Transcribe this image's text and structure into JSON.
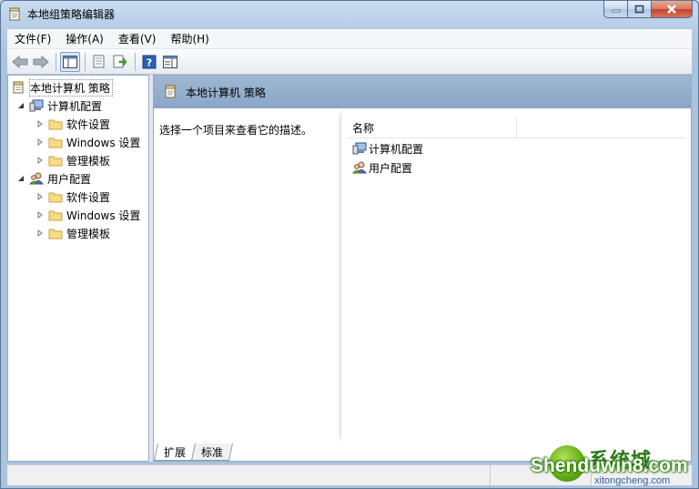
{
  "window": {
    "title": "本地组策略编辑器"
  },
  "menu": [
    "文件(F)",
    "操作(A)",
    "查看(V)",
    "帮助(H)"
  ],
  "toolbar": {
    "icons": [
      "back-arrow-icon",
      "forward-arrow-icon",
      "show-hide-tree-icon",
      "properties-icon",
      "export-list-icon",
      "help-icon",
      "action-pane-icon"
    ]
  },
  "tree": {
    "root": "本地计算机 策略",
    "computer": {
      "label": "计算机配置",
      "children": [
        "软件设置",
        "Windows 设置",
        "管理模板"
      ]
    },
    "user": {
      "label": "用户配置",
      "children": [
        "软件设置",
        "Windows 设置",
        "管理模板"
      ]
    }
  },
  "content": {
    "header_title": "本地计算机 策略",
    "description": "选择一个项目来查看它的描述。",
    "column_name": "名称",
    "items": [
      "计算机配置",
      "用户配置"
    ]
  },
  "tabs": [
    "扩展",
    "标准"
  ],
  "watermark": {
    "main": "Shenduwin8.com",
    "cn": "系统城",
    "sub": "xitongcheng.com"
  },
  "colors": {
    "header_band": "#8fa9c9",
    "title_gradient": "#c9dcf1"
  }
}
